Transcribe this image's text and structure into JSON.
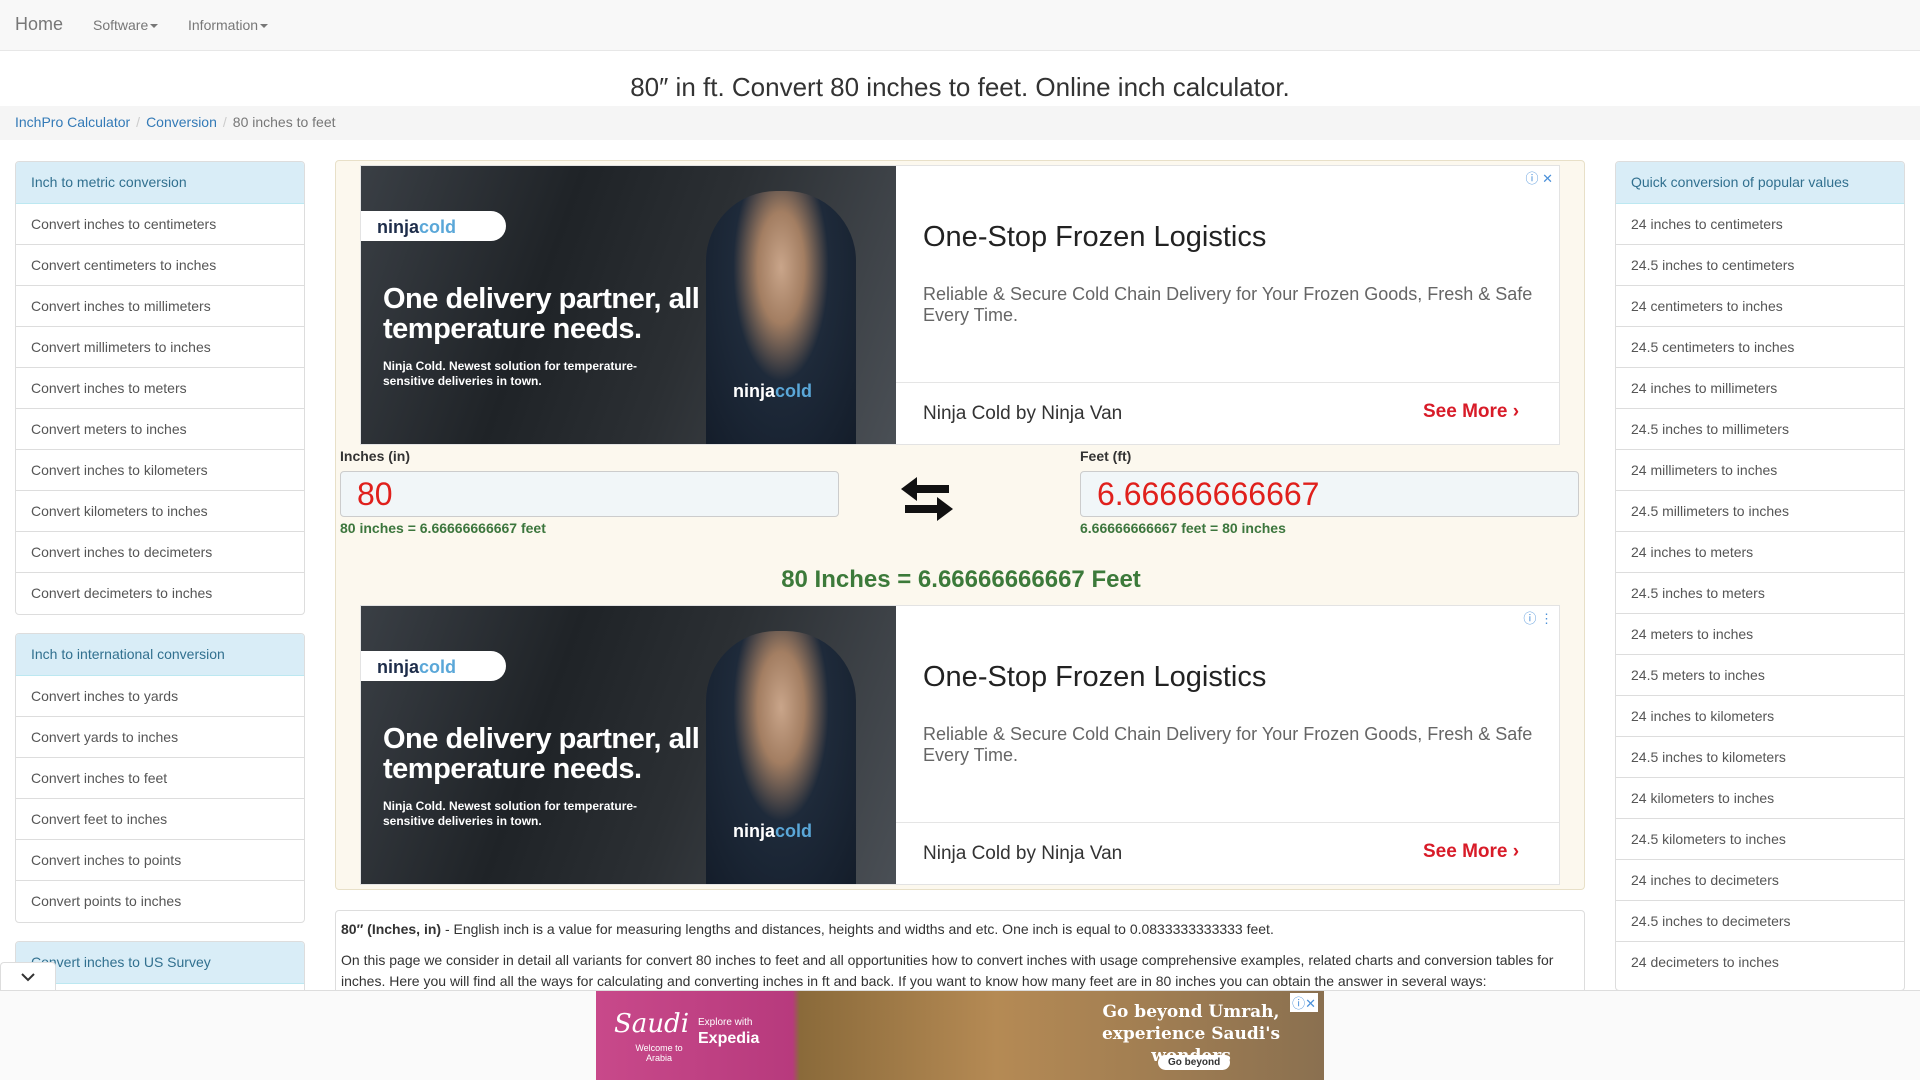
{
  "nav": {
    "home": "Home",
    "software": "Software",
    "information": "Information"
  },
  "page_title": "80″ in ft. Convert 80 inches to feet. Online inch calculator.",
  "breadcrumb": [
    "InchPro Calculator",
    "Conversion",
    "80 inches to feet"
  ],
  "left_sidebar": {
    "metric": {
      "heading": "Inch to metric conversion",
      "items": [
        "Convert inches to centimeters",
        "Convert centimeters to inches",
        "Convert inches to millimeters",
        "Convert millimeters to inches",
        "Convert inches to meters",
        "Convert meters to inches",
        "Convert inches to kilometers",
        "Convert kilometers to inches",
        "Convert inches to decimeters",
        "Convert decimeters to inches"
      ]
    },
    "international": {
      "heading": "Inch to international conversion",
      "items": [
        "Convert inches to yards",
        "Convert yards to inches",
        "Convert inches to feet",
        "Convert feet to inches",
        "Convert inches to points",
        "Convert points to inches"
      ]
    },
    "us_survey": {
      "heading": "Convert inches to US Survey"
    }
  },
  "right_sidebar": {
    "heading": "Quick conversion of popular values",
    "items": [
      "24 inches to centimeters",
      "24.5 inches to centimeters",
      "24 centimeters to inches",
      "24.5 centimeters to inches",
      "24 inches to millimeters",
      "24.5 inches to millimeters",
      "24 millimeters to inches",
      "24.5 millimeters to inches",
      "24 inches to meters",
      "24.5 inches to meters",
      "24 meters to inches",
      "24.5 meters to inches",
      "24 inches to kilometers",
      "24.5 inches to kilometers",
      "24 kilometers to inches",
      "24.5 kilometers to inches",
      "24 inches to decimeters",
      "24.5 inches to decimeters",
      "24 decimeters to inches"
    ]
  },
  "ad": {
    "logo_left": "ninja",
    "logo_right": "cold",
    "headline": "One delivery partner, all temperature needs.",
    "subline": "Ninja Cold. Newest solution for temperature-sensitive deliveries in town.",
    "title": "One-Stop Frozen Logistics",
    "description": "Reliable & Secure Cold Chain Delivery for Your Frozen Goods, Fresh & Safe Every Time.",
    "company": "Ninja Cold by Ninja Van",
    "cta": "See More"
  },
  "converter": {
    "inches_label": "Inches (in)",
    "inches_value": "80",
    "inches_note": "80 inches = 6.66666666667 feet",
    "feet_label": "Feet (ft)",
    "feet_value": "6.66666666667",
    "feet_note": "6.66666666667 feet = 80 inches",
    "result": "80 Inches = 6.66666666667 Feet"
  },
  "info": {
    "p1_bold": "80″ (Inches, in)",
    "p1_text": " - English inch is a value for measuring lengths and distances, heights and widths and etc. One inch is equal to 0.0833333333333 feet.",
    "p2": "On this page we consider in detail all variants for convert 80 inches to feet and all opportunities how to convert inches with usage comprehensive examples, related charts and conversion tables for inches. Here you will find all the ways for calculating and converting inches in ft and back. If you want to know how many feet are in 80 inches you can obtain the answer in several ways:"
  },
  "bottom_ad": {
    "brand": "Saudi",
    "brand_sub": "Welcome to Arabia",
    "partner_prefix": "Explore with",
    "partner": "Expedia",
    "tagline": "Go beyond Umrah, experience Saudi's wonders",
    "button": "Go beyond"
  },
  "colors": {
    "link": "#337ab7",
    "input_value": "#e0201c",
    "result_green": "#3c7a3a",
    "panel_bg": "#fcf8ee",
    "list_head_bg": "#d9edf7"
  }
}
